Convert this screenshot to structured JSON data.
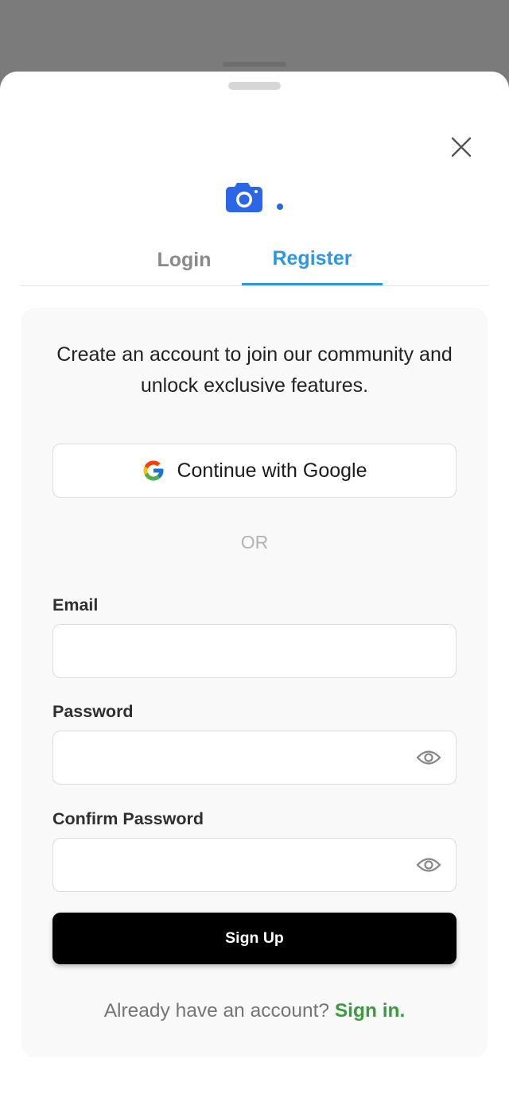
{
  "tabs": {
    "login_label": "Login",
    "register_label": "Register",
    "active": "register"
  },
  "register": {
    "subtitle": "Create an account to join our community and unlock exclusive features.",
    "google_button_label": "Continue with Google",
    "divider_text": "OR",
    "email_label": "Email",
    "email_value": "",
    "password_label": "Password",
    "password_value": "",
    "confirm_password_label": "Confirm Password",
    "confirm_password_value": "",
    "signup_button_label": "Sign Up",
    "footer_prompt": "Already have an account?",
    "signin_link_label": "Sign in."
  },
  "icons": {
    "close": "close-icon",
    "logo": "camera-icon",
    "google": "google-icon",
    "show_password": "eye-icon"
  },
  "colors": {
    "accent_blue": "#2f97e0",
    "logo_blue": "#2b66e6",
    "link_green": "#3c9a3f",
    "button_black": "#000000"
  }
}
